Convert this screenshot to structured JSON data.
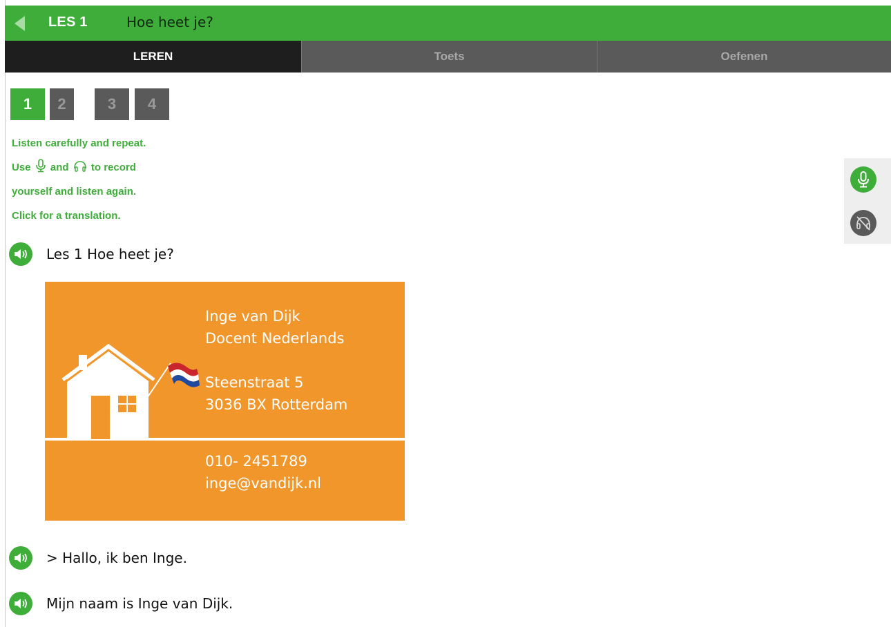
{
  "header": {
    "lesson_label": "LES 1",
    "lesson_title": "Hoe heet je?"
  },
  "tabs": [
    {
      "label": "LEREN",
      "active": true
    },
    {
      "label": "Toets",
      "active": false
    },
    {
      "label": "Oefenen",
      "active": false
    }
  ],
  "steps": [
    {
      "label": "1",
      "active": true
    },
    {
      "label": "2",
      "active": false
    },
    {
      "label": "3",
      "active": false
    },
    {
      "label": "4",
      "active": false
    }
  ],
  "instructions": {
    "line1": "Listen carefully and repeat.",
    "line2_a": "Use",
    "line2_b": "and",
    "line2_c": "to record",
    "line3": "yourself and listen again.",
    "line4": "Click for a translation."
  },
  "audio_lines": [
    {
      "text": "Les 1 Hoe heet je?"
    },
    {
      "text": "> Hallo, ik ben Inge."
    },
    {
      "text": "Mijn naam is Inge van Dijk."
    }
  ],
  "card": {
    "name": "Inge van Dijk",
    "role": "Docent Nederlands",
    "street": "Steenstraat 5",
    "city": "3036 BX Rotterdam",
    "phone": "010- 2451789",
    "email": "inge@vandijk.nl"
  },
  "colors": {
    "brand_green": "#3fad3a",
    "tab_dark": "#1e1e1e",
    "tab_inactive": "#5a5a5a",
    "card_orange": "#f0962a"
  },
  "icons": {
    "back": "back-arrow-icon",
    "speaker": "speaker-icon",
    "microphone": "microphone-icon",
    "headphones": "headphones-icon"
  }
}
